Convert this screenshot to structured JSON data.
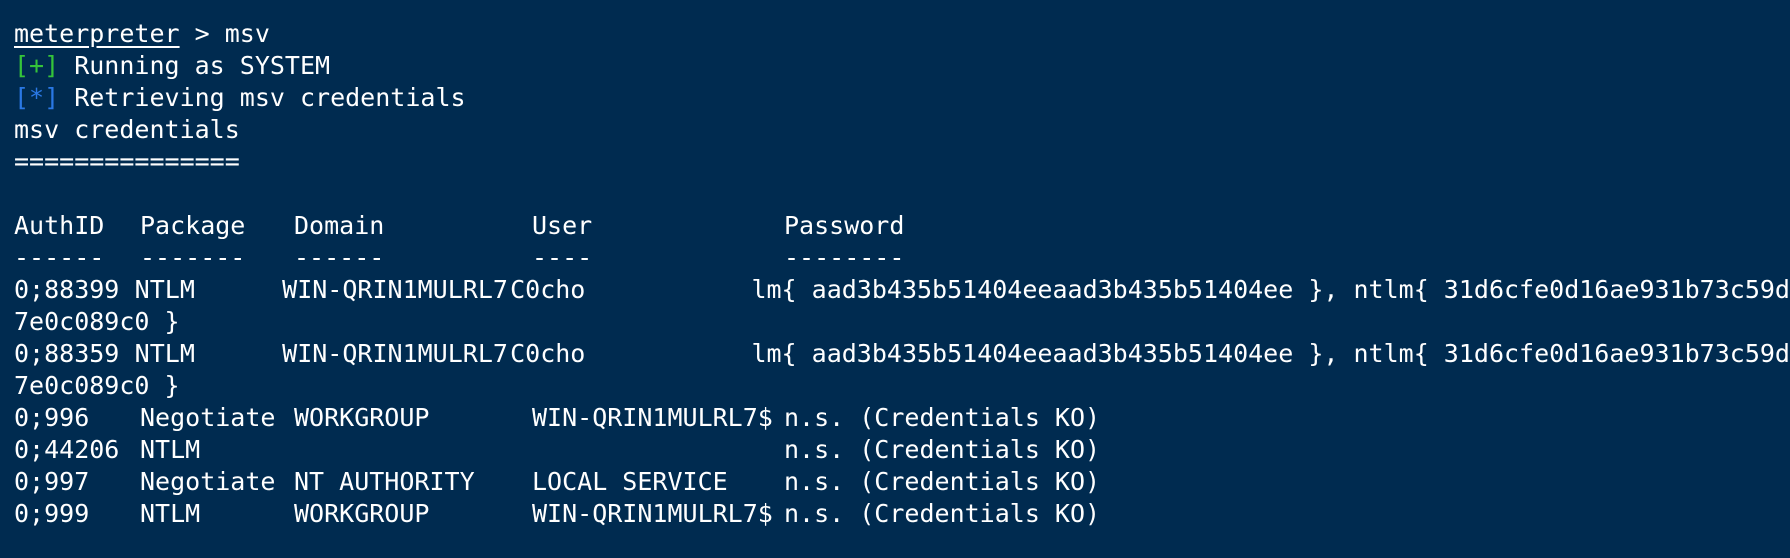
{
  "colors": {
    "background": "#002b50",
    "text": "#ffffff",
    "success": "#35c43a",
    "info": "#2a78e4"
  },
  "prompt": {
    "name": "meterpreter",
    "separator": " > ",
    "command": "msv"
  },
  "messages": [
    {
      "marker": "[+]",
      "text": " Running as SYSTEM"
    },
    {
      "marker": "[*]",
      "text": " Retrieving msv credentials"
    }
  ],
  "section": {
    "title": "msv credentials",
    "underline": "==============="
  },
  "table": {
    "headers": [
      "AuthID",
      "Package",
      "Domain",
      "User",
      "Password"
    ],
    "separators": [
      "------",
      "-------",
      "------",
      "----",
      "--------"
    ],
    "rows": [
      {
        "authid": "0;88399",
        "package": "NTLM",
        "domain": "WIN-QRIN1MULRL7",
        "user": "C0cho",
        "password": "lm{ aad3b435b51404eeaad3b435b51404ee }, ntlm{ 31d6cfe0d16ae931b73c59d",
        "wrap": "7e0c089c0 }"
      },
      {
        "authid": "0;88359",
        "package": "NTLM",
        "domain": "WIN-QRIN1MULRL7",
        "user": "C0cho",
        "password": "lm{ aad3b435b51404eeaad3b435b51404ee }, ntlm{ 31d6cfe0d16ae931b73c59d",
        "wrap": "7e0c089c0 }"
      },
      {
        "authid": "0;996",
        "package": "Negotiate",
        "domain": "WORKGROUP",
        "user": "WIN-QRIN1MULRL7$",
        "password": "n.s. (Credentials KO)"
      },
      {
        "authid": "0;44206",
        "package": "NTLM",
        "domain": "",
        "user": "",
        "password": "n.s. (Credentials KO)"
      },
      {
        "authid": "0;997",
        "package": "Negotiate",
        "domain": "NT AUTHORITY",
        "user": "LOCAL SERVICE",
        "password": "n.s. (Credentials KO)"
      },
      {
        "authid": "0;999",
        "package": "NTLM",
        "domain": "WORKGROUP",
        "user": "WIN-QRIN1MULRL7$",
        "password": "n.s. (Credentials KO)"
      }
    ]
  }
}
